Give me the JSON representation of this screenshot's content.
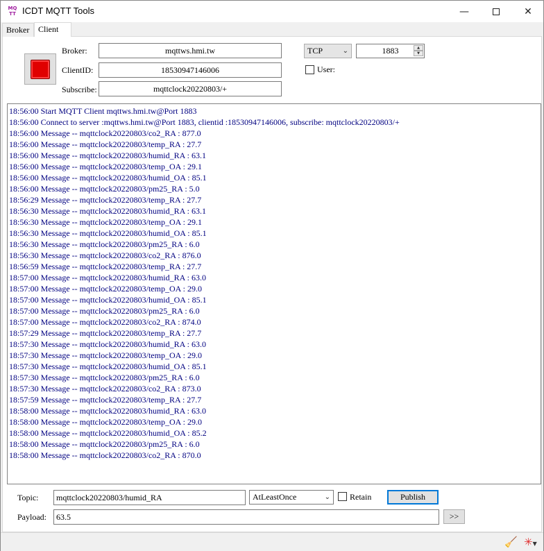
{
  "window": {
    "title": "ICDT MQTT Tools",
    "icon_text": "MQ TT"
  },
  "tabs": [
    {
      "label": "Broker",
      "active": false
    },
    {
      "label": "Client",
      "active": true
    }
  ],
  "connection": {
    "broker_label": "Broker:",
    "broker_value": "mqttws.hmi.tw",
    "clientid_label": "ClientID:",
    "clientid_value": "18530947146006",
    "subscribe_label": "Subscribe:",
    "subscribe_value": "mqttclock20220803/+",
    "protocol_selected": "TCP",
    "port_value": "1883",
    "user_label": "User:",
    "user_checked": false,
    "stop_button_color": "#e00000"
  },
  "log": [
    "18:56:00 Start MQTT  Client mqttws.hmi.tw@Port 1883",
    "18:56:00 Connect to server :mqttws.hmi.tw@Port 1883, clientid :18530947146006, subscribe: mqttclock20220803/+",
    "18:56:00 Message -- mqttclock20220803/co2_RA : 877.0",
    "18:56:00 Message -- mqttclock20220803/temp_RA : 27.7",
    "18:56:00 Message -- mqttclock20220803/humid_RA : 63.1",
    "18:56:00 Message -- mqttclock20220803/temp_OA : 29.1",
    "18:56:00 Message -- mqttclock20220803/humid_OA : 85.1",
    "18:56:00 Message -- mqttclock20220803/pm25_RA : 5.0",
    "18:56:29 Message -- mqttclock20220803/temp_RA : 27.7",
    "18:56:30 Message -- mqttclock20220803/humid_RA : 63.1",
    "18:56:30 Message -- mqttclock20220803/temp_OA : 29.1",
    "18:56:30 Message -- mqttclock20220803/humid_OA : 85.1",
    "18:56:30 Message -- mqttclock20220803/pm25_RA : 6.0",
    "18:56:30 Message -- mqttclock20220803/co2_RA : 876.0",
    "18:56:59 Message -- mqttclock20220803/temp_RA : 27.7",
    "18:57:00 Message -- mqttclock20220803/humid_RA : 63.0",
    "18:57:00 Message -- mqttclock20220803/temp_OA : 29.0",
    "18:57:00 Message -- mqttclock20220803/humid_OA : 85.1",
    "18:57:00 Message -- mqttclock20220803/pm25_RA : 6.0",
    "18:57:00 Message -- mqttclock20220803/co2_RA : 874.0",
    "18:57:29 Message -- mqttclock20220803/temp_RA : 27.7",
    "18:57:30 Message -- mqttclock20220803/humid_RA : 63.0",
    "18:57:30 Message -- mqttclock20220803/temp_OA : 29.0",
    "18:57:30 Message -- mqttclock20220803/humid_OA : 85.1",
    "18:57:30 Message -- mqttclock20220803/pm25_RA : 6.0",
    "18:57:30 Message -- mqttclock20220803/co2_RA : 873.0",
    "18:57:59 Message -- mqttclock20220803/temp_RA : 27.7",
    "18:58:00 Message -- mqttclock20220803/humid_RA : 63.0",
    "18:58:00 Message -- mqttclock20220803/temp_OA : 29.0",
    "18:58:00 Message -- mqttclock20220803/humid_OA : 85.2",
    "18:58:00 Message -- mqttclock20220803/pm25_RA : 6.0",
    "18:58:00 Message -- mqttclock20220803/co2_RA : 870.0"
  ],
  "publish": {
    "topic_label": "Topic:",
    "topic_value": "mqttclock20220803/humid_RA",
    "qos_selected": "AtLeastOnce",
    "retain_label": "Retain",
    "retain_checked": false,
    "publish_label": "Publish",
    "payload_label": "Payload:",
    "payload_value": "63.5",
    "more_label": ">>"
  },
  "statusbar": {
    "icons": [
      "broom-icon",
      "settings-star-icon"
    ]
  }
}
